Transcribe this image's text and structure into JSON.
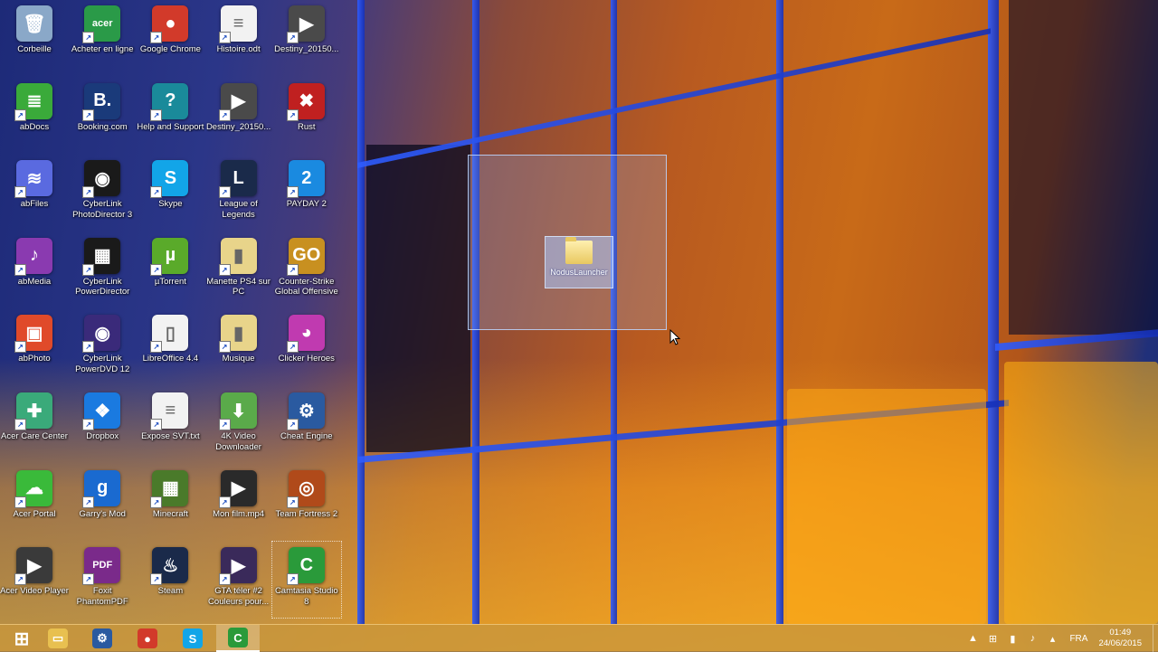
{
  "desktop": {
    "icons": [
      {
        "label": "Corbeille",
        "glyph": "🗑",
        "color": "#8aa8c8",
        "icon": "recycle-bin-icon"
      },
      {
        "label": "Acheter en ligne",
        "glyph": "acer",
        "color": "#2a9a48",
        "icon": "shopping-bag-icon"
      },
      {
        "label": "Google Chrome",
        "glyph": "●",
        "color": "#d23a2a",
        "icon": "chrome-icon"
      },
      {
        "label": "Histoire.odt",
        "glyph": "≡",
        "color": "#f2f2f2",
        "icon": "document-icon"
      },
      {
        "label": "Destiny_20150...",
        "glyph": "▶",
        "color": "#4a4a4a",
        "icon": "video-file-icon"
      },
      {
        "label": "abDocs",
        "glyph": "≣",
        "color": "#3aaa3a",
        "icon": "abdocs-icon"
      },
      {
        "label": "Booking.com",
        "glyph": "B.",
        "color": "#1a3a7a",
        "icon": "booking-icon"
      },
      {
        "label": "Help and Support",
        "glyph": "?",
        "color": "#1a8a9a",
        "icon": "help-icon"
      },
      {
        "label": "Destiny_20150...",
        "glyph": "▶",
        "color": "#4a4a4a",
        "icon": "video-file-icon"
      },
      {
        "label": "Rust",
        "glyph": "✖",
        "color": "#c02020",
        "icon": "rust-icon"
      },
      {
        "label": "abFiles",
        "glyph": "≋",
        "color": "#5a6ae0",
        "icon": "abfiles-icon"
      },
      {
        "label": "CyberLink PhotoDirector 3",
        "glyph": "◉",
        "color": "#1a1a1a",
        "icon": "photodirector-icon"
      },
      {
        "label": "Skype",
        "glyph": "S",
        "color": "#12a5e8",
        "icon": "skype-icon"
      },
      {
        "label": "League of Legends",
        "glyph": "L",
        "color": "#1a2a4a",
        "icon": "league-of-legends-icon"
      },
      {
        "label": "PAYDAY 2",
        "glyph": "2",
        "color": "#1a8ae0",
        "icon": "payday-icon"
      },
      {
        "label": "abMedia",
        "glyph": "♪",
        "color": "#8a3ab0",
        "icon": "abmedia-icon"
      },
      {
        "label": "CyberLink PowerDirector",
        "glyph": "▦",
        "color": "#1a1a1a",
        "icon": "powerdirector-icon"
      },
      {
        "label": "µTorrent",
        "glyph": "µ",
        "color": "#5aaa2a",
        "icon": "utorrent-icon"
      },
      {
        "label": "Manette PS4 sur PC",
        "glyph": "▮",
        "color": "#e8d48a",
        "icon": "folder-icon"
      },
      {
        "label": "Counter-Strike Global Offensive",
        "glyph": "GO",
        "color": "#c89020",
        "icon": "csgo-icon"
      },
      {
        "label": "abPhoto",
        "glyph": "▣",
        "color": "#e04a2a",
        "icon": "abphoto-icon"
      },
      {
        "label": "CyberLink PowerDVD 12",
        "glyph": "◉",
        "color": "#3a2a7a",
        "icon": "powerdvd-icon"
      },
      {
        "label": "LibreOffice 4.4",
        "glyph": "▯",
        "color": "#f2f2f2",
        "icon": "libreoffice-icon"
      },
      {
        "label": "Musique",
        "glyph": "▮",
        "color": "#e8d48a",
        "icon": "folder-icon"
      },
      {
        "label": "Clicker Heroes",
        "glyph": "◕",
        "color": "#c03ab0",
        "icon": "clicker-heroes-icon"
      },
      {
        "label": "Acer Care Center",
        "glyph": "✚",
        "color": "#3aaa7a",
        "icon": "acer-care-icon"
      },
      {
        "label": "Dropbox",
        "glyph": "❖",
        "color": "#1a7ae0",
        "icon": "dropbox-icon"
      },
      {
        "label": "Expose SVT.txt",
        "glyph": "≡",
        "color": "#f2f2f2",
        "icon": "text-file-icon"
      },
      {
        "label": "4K Video Downloader",
        "glyph": "⬇",
        "color": "#5aaa4a",
        "icon": "4k-downloader-icon"
      },
      {
        "label": "Cheat Engine",
        "glyph": "⚙",
        "color": "#2a5aa0",
        "icon": "cheat-engine-icon"
      },
      {
        "label": "Acer Portal",
        "glyph": "☁",
        "color": "#3aba3a",
        "icon": "acer-portal-icon"
      },
      {
        "label": "Garry's Mod",
        "glyph": "g",
        "color": "#1a6ad0",
        "icon": "garrys-mod-icon"
      },
      {
        "label": "Minecraft",
        "glyph": "▦",
        "color": "#4a7a2a",
        "icon": "minecraft-icon"
      },
      {
        "label": "Mon film.mp4",
        "glyph": "▶",
        "color": "#2a2a2a",
        "icon": "video-file-icon"
      },
      {
        "label": "Team Fortress 2",
        "glyph": "◎",
        "color": "#b04a1a",
        "icon": "tf2-icon"
      },
      {
        "label": "Acer Video Player",
        "glyph": "▶",
        "color": "#3a3a3a",
        "icon": "acer-video-player-icon"
      },
      {
        "label": "Foxit PhantomPDF",
        "glyph": "PDF",
        "color": "#7a2a8a",
        "icon": "foxit-icon"
      },
      {
        "label": "Steam",
        "glyph": "♨",
        "color": "#1a2a4a",
        "icon": "steam-icon"
      },
      {
        "label": "GTA téler #2 Couleurs pour...",
        "glyph": "▶",
        "color": "#3a2a5a",
        "icon": "video-file-icon"
      },
      {
        "label": "Camtasia Studio 8",
        "glyph": "C",
        "color": "#2a9a3a",
        "icon": "camtasia-icon"
      }
    ],
    "drag_item": {
      "label": "NodusLauncher"
    }
  },
  "taskbar": {
    "buttons": [
      {
        "name": "start-button",
        "glyph": "⊞",
        "color": "transparent",
        "active": false
      },
      {
        "name": "taskbar-file-explorer",
        "glyph": "▭",
        "color": "#e8c050",
        "active": false
      },
      {
        "name": "taskbar-cheat-engine",
        "glyph": "⚙",
        "color": "#2a5aa0",
        "active": false
      },
      {
        "name": "taskbar-chrome",
        "glyph": "●",
        "color": "#d23a2a",
        "active": false
      },
      {
        "name": "taskbar-skype",
        "glyph": "S",
        "color": "#12a5e8",
        "active": false
      },
      {
        "name": "taskbar-camtasia",
        "glyph": "C",
        "color": "#2a9a3a",
        "active": true
      }
    ],
    "tray": {
      "language": "FRA",
      "time": "01:49",
      "date": "24/06/2015"
    }
  }
}
